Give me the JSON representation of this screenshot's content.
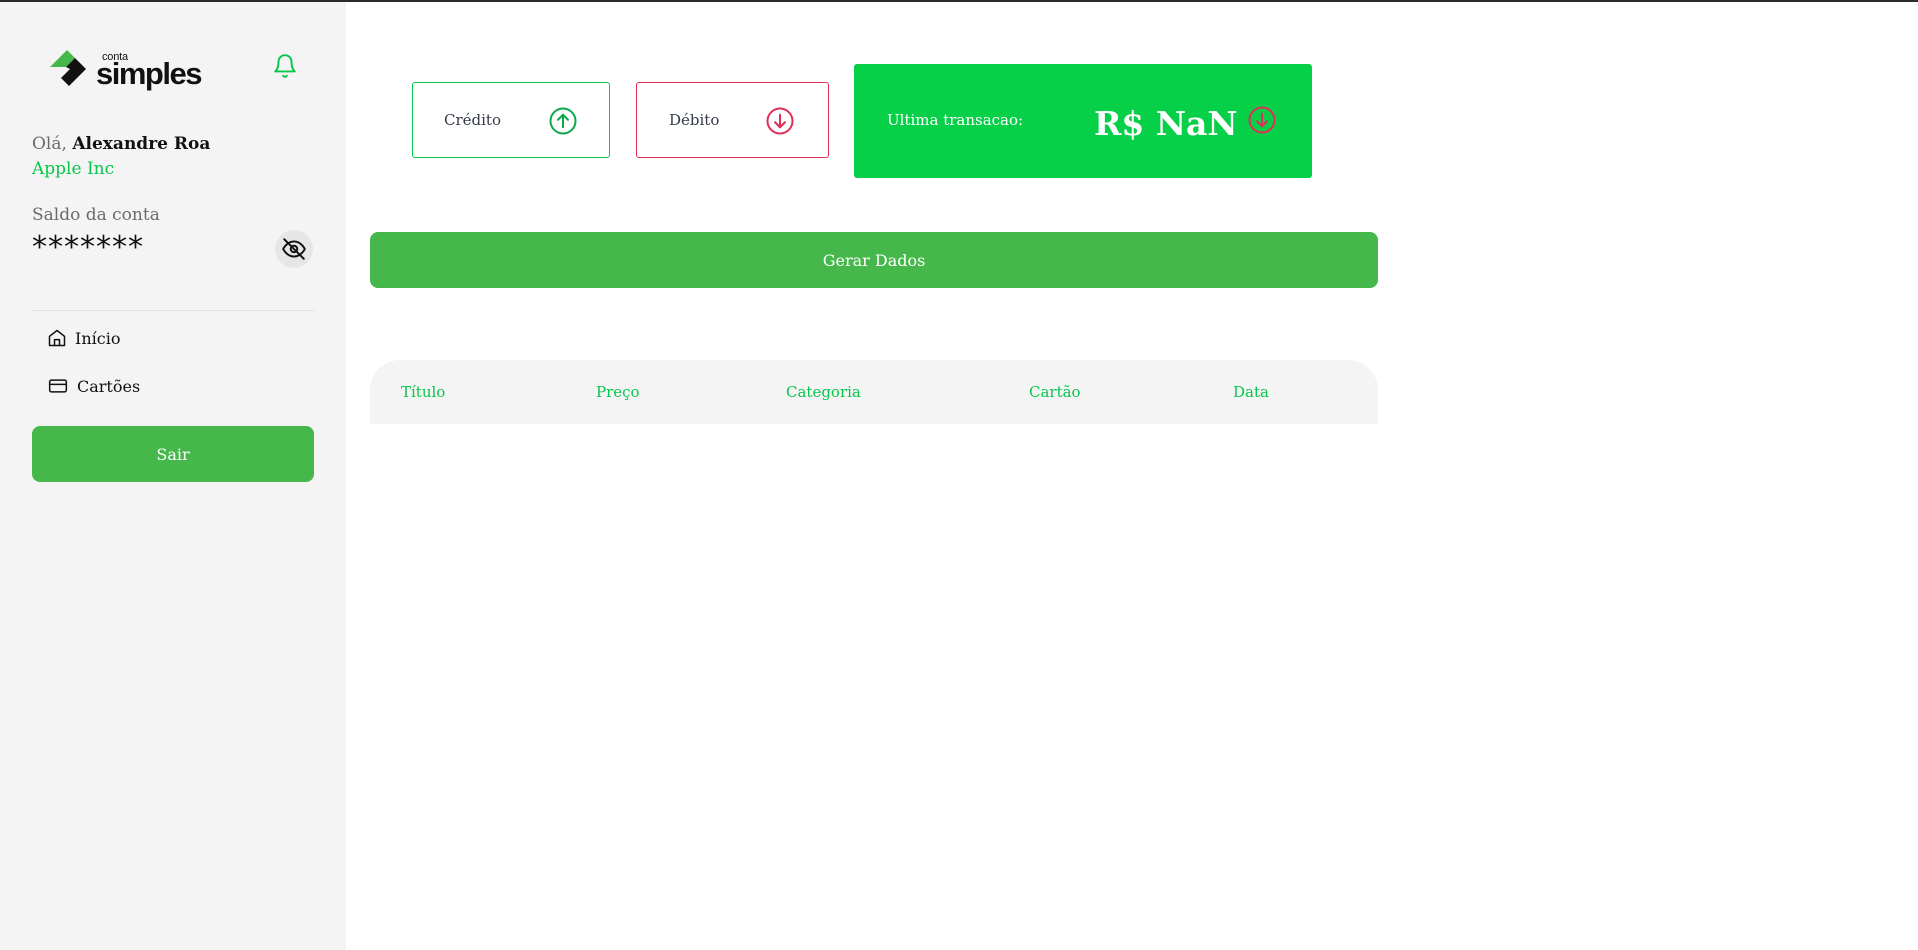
{
  "colors": {
    "brand_green": "#07c64b",
    "button_green": "#46b84b",
    "last_card_green": "#06cf48",
    "debit_red": "#e02e57",
    "sidebar_bg": "#f4f4f4"
  },
  "sidebar": {
    "logo": {
      "small": "conta",
      "large": "simples"
    },
    "notifications_icon": "bell-icon",
    "greeting_prefix": "Olá,",
    "user_name": "Alexandre Roa",
    "company": "Apple Inc",
    "balance_label": "Saldo da conta",
    "balance_value": "*******",
    "visibility_icon": "eye-off-icon",
    "nav": [
      {
        "label": "Início",
        "icon": "home-icon"
      },
      {
        "label": "Cartões",
        "icon": "credit-card-icon"
      }
    ],
    "logout_label": "Sair"
  },
  "summary": {
    "credit_label": "Crédito",
    "credit_icon": "arrow-up-circle-icon",
    "debit_label": "Débito",
    "debit_icon": "arrow-down-circle-icon",
    "last_transaction_label": "Ultima transacao:",
    "last_transaction_value": "R$ NaN",
    "last_transaction_icon": "arrow-down-circle-icon"
  },
  "generate_button_label": "Gerar Dados",
  "table": {
    "columns": [
      "Título",
      "Preço",
      "Categoria",
      "Cartão",
      "Data"
    ],
    "rows": []
  }
}
